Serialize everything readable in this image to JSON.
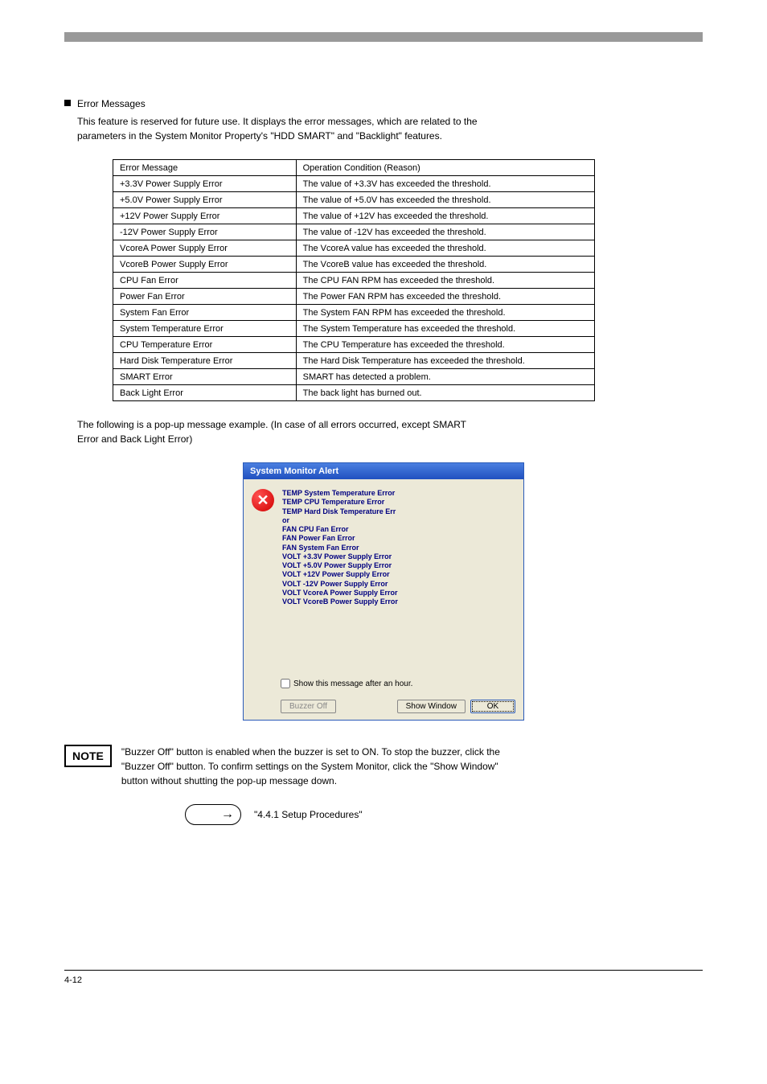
{
  "section": {
    "title": "Error Messages",
    "description_line1": "This feature is reserved for future use. It displays the error messages, which are related to the",
    "description_line2": "parameters in the System Monitor Property's \"HDD SMART\" and \"Backlight\" features."
  },
  "table": {
    "header_left": "Error Message",
    "header_right": "Operation Condition (Reason)",
    "rows": [
      {
        "msg": "+3.3V Power Supply Error",
        "cond": "The value of +3.3V has exceeded the threshold."
      },
      {
        "msg": "+5.0V Power Supply Error",
        "cond": "The value of +5.0V has exceeded the threshold."
      },
      {
        "msg": "+12V Power Supply Error",
        "cond": "The value of +12V has exceeded the threshold."
      },
      {
        "msg": "-12V Power Supply Error",
        "cond": "The value of -12V has exceeded the threshold."
      },
      {
        "msg": "VcoreA Power Supply Error",
        "cond": "The VcoreA value has exceeded the threshold."
      },
      {
        "msg": "VcoreB Power Supply Error",
        "cond": "The VcoreB value has exceeded the threshold."
      },
      {
        "msg": "CPU Fan Error",
        "cond": "The CPU FAN RPM has exceeded the threshold."
      },
      {
        "msg": "Power Fan Error",
        "cond": "The Power FAN RPM has exceeded the threshold."
      },
      {
        "msg": "System Fan Error",
        "cond": "The System FAN RPM has exceeded the threshold."
      },
      {
        "msg": "System Temperature Error",
        "cond": "The System Temperature has exceeded the threshold."
      },
      {
        "msg": "CPU Temperature Error",
        "cond": "The CPU Temperature has exceeded the threshold."
      },
      {
        "msg": "Hard Disk Temperature Error",
        "cond": "The Hard Disk Temperature has exceeded the threshold."
      },
      {
        "msg": "SMART Error",
        "cond": "SMART has detected a problem."
      },
      {
        "msg": "Back Light Error",
        "cond": "The back light has burned out."
      }
    ]
  },
  "popup": {
    "intro_line1": "The following is a pop-up message example. (In case of all errors occurred, except SMART",
    "intro_line2": "Error and Back Light Error)",
    "title": "System Monitor Alert",
    "lines": [
      "TEMP System Temperature Error",
      "TEMP CPU Temperature Error",
      "TEMP Hard Disk Temperature Err",
      "or",
      "FAN CPU Fan Error",
      "FAN Power Fan Error",
      "FAN System Fan Error",
      "VOLT +3.3V Power Supply Error",
      "VOLT +5.0V Power Supply Error",
      "VOLT +12V Power Supply Error",
      "VOLT -12V Power Supply Error",
      "VOLT VcoreA Power Supply Error",
      "VOLT VcoreB Power Supply Error"
    ],
    "checkbox_label": "Show this message after an hour.",
    "buzzer_btn": "Buzzer Off",
    "show_window_btn": "Show Window",
    "ok_btn": "OK"
  },
  "note": {
    "label": "NOTE",
    "text_line1": "\"Buzzer Off\" button is enabled when the buzzer is set to ON. To stop the buzzer, click the",
    "text_line2": "\"Buzzer Off\" button. To confirm settings on the System Monitor, click the \"Show Window\"",
    "text_line3": "button without shutting the pop-up message down.",
    "reference": "\"4.4.1 Setup Procedures\""
  },
  "footer": {
    "left": "4-12",
    "right": ""
  }
}
